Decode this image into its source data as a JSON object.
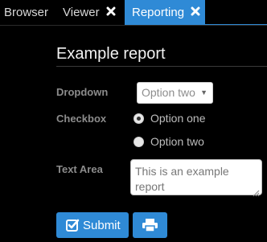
{
  "tabs": [
    {
      "label": "Browser"
    },
    {
      "label": "Viewer"
    },
    {
      "label": "Reporting"
    }
  ],
  "report": {
    "title": "Example report",
    "dropdown": {
      "label": "Dropdown",
      "selected": "Option two"
    },
    "checkbox": {
      "label": "Checkbox",
      "options": [
        "Option one",
        "Option two"
      ],
      "selected": "Option one"
    },
    "textarea": {
      "label": "Text Area",
      "value": "This is an example report"
    },
    "buttons": {
      "submit_label": "Submit",
      "print_icon": "print-icon"
    }
  },
  "colors": {
    "accent": "#2f8ad6",
    "background": "#000000",
    "label": "#8c8c8c"
  }
}
